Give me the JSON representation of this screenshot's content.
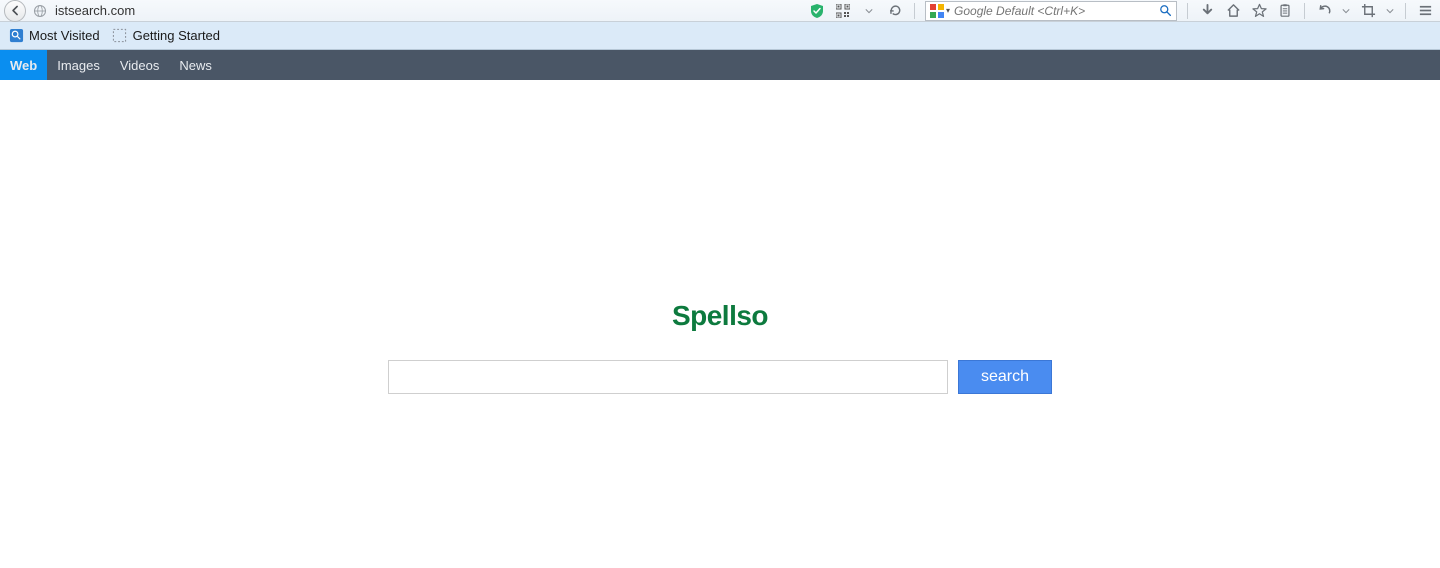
{
  "browser": {
    "url": "istsearch.com",
    "search_placeholder": "Google Default <Ctrl+K>"
  },
  "bookmarks": {
    "most_visited": "Most Visited",
    "getting_started": "Getting Started"
  },
  "nav": {
    "web": "Web",
    "images": "Images",
    "videos": "Videos",
    "news": "News"
  },
  "page": {
    "logo": "Spellso",
    "search_button": "search"
  }
}
